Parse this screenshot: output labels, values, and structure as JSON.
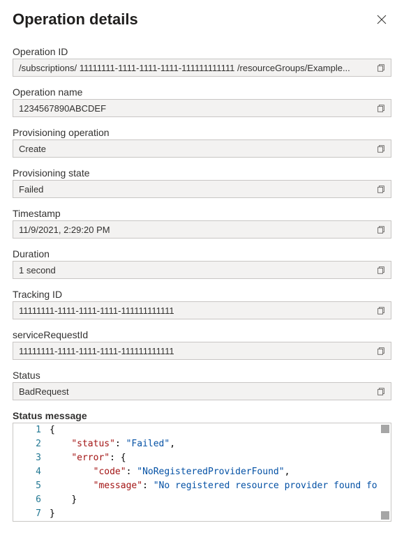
{
  "header": {
    "title": "Operation details"
  },
  "fields": {
    "operationId": {
      "label": "Operation ID",
      "value": "/subscriptions/ 11111111-1111-1111-1111-111111111111 /resourceGroups/Example..."
    },
    "operationName": {
      "label": "Operation name",
      "value": "1234567890ABCDEF"
    },
    "provisioningOperation": {
      "label": "Provisioning operation",
      "value": "Create"
    },
    "provisioningState": {
      "label": "Provisioning state",
      "value": "Failed"
    },
    "timestamp": {
      "label": "Timestamp",
      "value": "11/9/2021, 2:29:20 PM"
    },
    "duration": {
      "label": "Duration",
      "value": "1 second"
    },
    "trackingId": {
      "label": "Tracking ID",
      "value": "11111111-1111-1111-1111-111111111111"
    },
    "serviceRequestId": {
      "label": "serviceRequestId",
      "value": "11111111-1111-1111-1111-111111111111"
    },
    "status": {
      "label": "Status",
      "value": "BadRequest"
    }
  },
  "statusMessage": {
    "label": "Status message",
    "gutters": [
      "1",
      "2",
      "3",
      "4",
      "5",
      "6",
      "7"
    ],
    "json": {
      "status": "Failed",
      "error": {
        "code": "NoRegisteredProviderFound",
        "message": "No registered resource provider found fo"
      }
    },
    "tokens": {
      "l2_key": "\"status\"",
      "l2_val": "\"Failed\"",
      "l3_key": "\"error\"",
      "l4_key": "\"code\"",
      "l4_val": "\"NoRegisteredProviderFound\"",
      "l5_key": "\"message\"",
      "l5_val": "\"No registered resource provider found fo"
    }
  }
}
